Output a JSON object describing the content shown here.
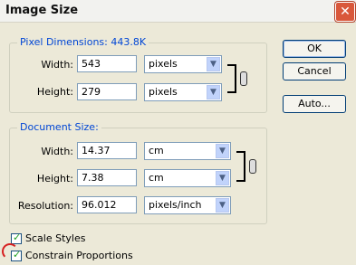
{
  "window": {
    "title": "Image Size",
    "close_glyph": "✕"
  },
  "pixel_dimensions": {
    "legend": "Pixel Dimensions:",
    "size": "443.8K",
    "width_label": "Width:",
    "width_value": "543",
    "width_unit": "pixels",
    "height_label": "Height:",
    "height_value": "279",
    "height_unit": "pixels"
  },
  "document_size": {
    "legend": "Document Size:",
    "width_label": "Width:",
    "width_value": "14.37",
    "width_unit": "cm",
    "height_label": "Height:",
    "height_value": "7.38",
    "height_unit": "cm",
    "resolution_label": "Resolution:",
    "resolution_value": "96.012",
    "resolution_unit": "pixels/inch"
  },
  "buttons": {
    "ok": "OK",
    "cancel": "Cancel",
    "auto": "Auto..."
  },
  "options": {
    "scale_styles": {
      "label": "Scale Styles",
      "checked": true
    },
    "constrain_proportions": {
      "label": "Constrain Proportions",
      "checked": true
    }
  },
  "icons": {
    "dropdown_arrow": "chevron-down-icon",
    "link": "chain-link-icon",
    "check": "checkmark-icon"
  },
  "colors": {
    "accent": "#0046d5",
    "close": "#d9583b",
    "annotation": "#d62020"
  }
}
